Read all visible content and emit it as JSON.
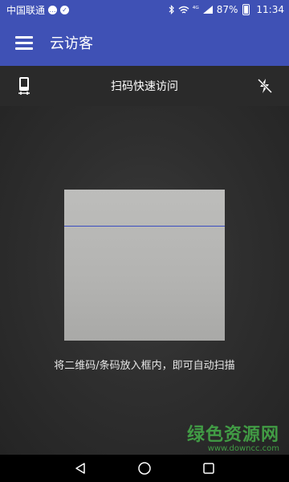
{
  "status_bar": {
    "carrier": "中国联通",
    "signal": "⁴ᴳ",
    "battery": "87%",
    "time": "11:34"
  },
  "app_bar": {
    "title": "云访客"
  },
  "scan_toolbar": {
    "title": "扫码快速访问"
  },
  "scanner": {
    "hint": "将二维码/条码放入框内，即可自动扫描",
    "scan_line_color": "#3b4dc0"
  },
  "watermark": {
    "title": "绿色资源网",
    "url": "www.downcc.com"
  },
  "colors": {
    "primary": "#3f51b5",
    "toolbar": "#2a2a2a"
  },
  "icons": {
    "menu": "hamburger-icon",
    "phone": "phone-icon",
    "flash": "flash-off-icon",
    "back": "back-triangle-icon",
    "home": "home-circle-icon",
    "recents": "recents-square-icon"
  }
}
